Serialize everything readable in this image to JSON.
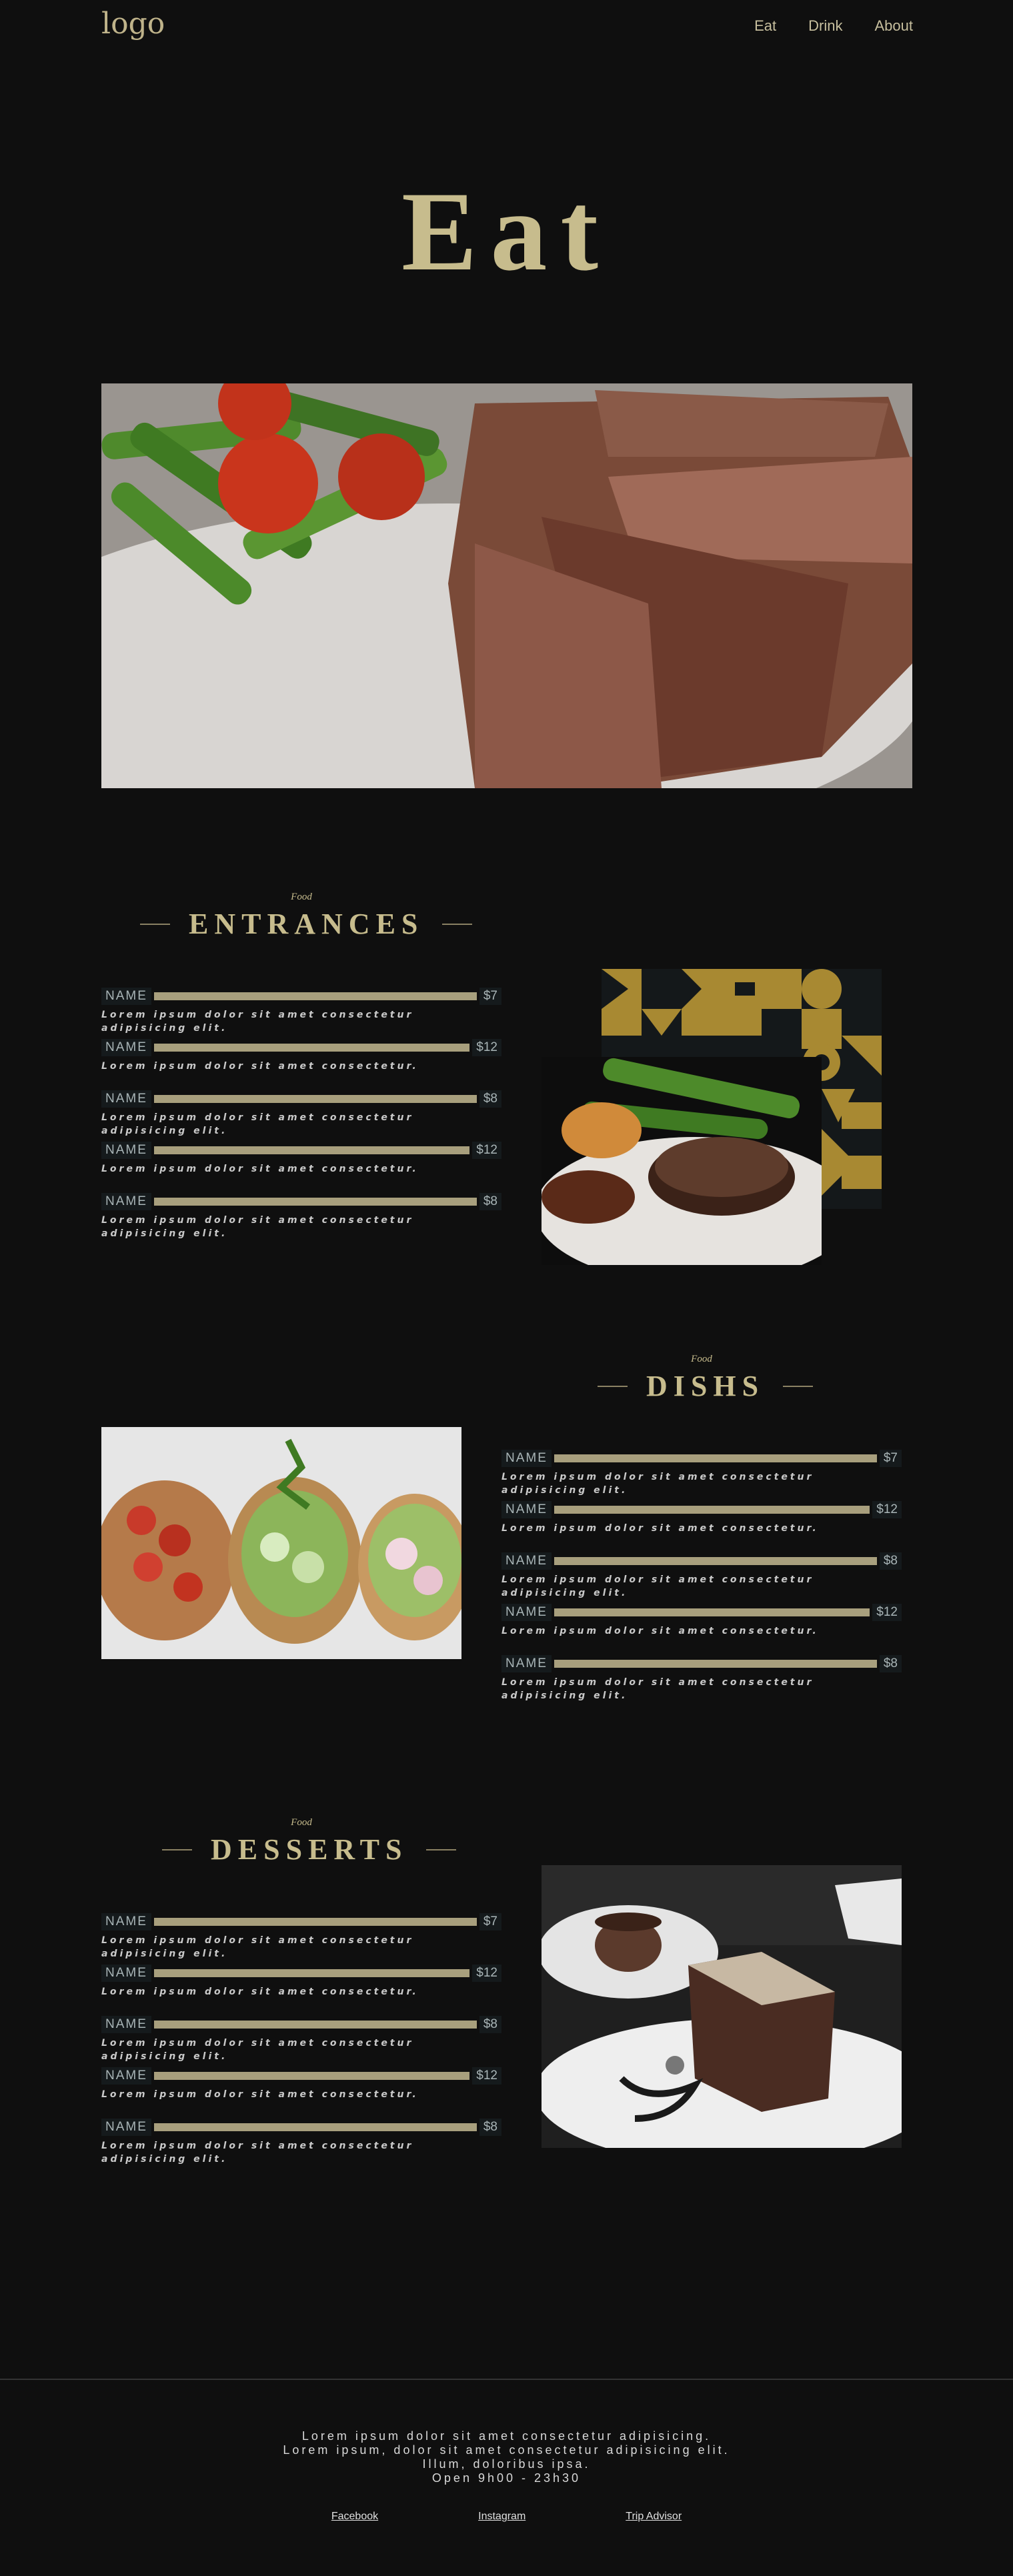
{
  "nav": {
    "logo": "logo",
    "links": [
      "Eat",
      "Drink",
      "About"
    ]
  },
  "hero": {
    "title": "Eat"
  },
  "sections": [
    {
      "kicker": "Food",
      "title": "ENTRANCES",
      "items": [
        {
          "name": "NAME",
          "price": "$7",
          "desc": "Lorem ipsum dolor sit amet consectetur adipisicing elit."
        },
        {
          "name": "NAME",
          "price": "$12",
          "desc": "Lorem ipsum dolor sit amet consectetur."
        },
        {
          "name": "NAME",
          "price": "$8",
          "desc": "Lorem ipsum dolor sit amet consectetur adipisicing elit."
        },
        {
          "name": "NAME",
          "price": "$12",
          "desc": "Lorem ipsum dolor sit amet consectetur."
        },
        {
          "name": "NAME",
          "price": "$8",
          "desc": "Lorem ipsum dolor sit amet consectetur adipisicing elit."
        }
      ]
    },
    {
      "kicker": "Food",
      "title": "DISHS",
      "items": [
        {
          "name": "NAME",
          "price": "$7",
          "desc": "Lorem ipsum dolor sit amet consectetur adipisicing elit."
        },
        {
          "name": "NAME",
          "price": "$12",
          "desc": "Lorem ipsum dolor sit amet consectetur."
        },
        {
          "name": "NAME",
          "price": "$8",
          "desc": "Lorem ipsum dolor sit amet consectetur adipisicing elit."
        },
        {
          "name": "NAME",
          "price": "$12",
          "desc": "Lorem ipsum dolor sit amet consectetur."
        },
        {
          "name": "NAME",
          "price": "$8",
          "desc": "Lorem ipsum dolor sit amet consectetur adipisicing elit."
        }
      ]
    },
    {
      "kicker": "Food",
      "title": "DESSERTS",
      "items": [
        {
          "name": "NAME",
          "price": "$7",
          "desc": "Lorem ipsum dolor sit amet consectetur adipisicing elit."
        },
        {
          "name": "NAME",
          "price": "$12",
          "desc": "Lorem ipsum dolor sit amet consectetur."
        },
        {
          "name": "NAME",
          "price": "$8",
          "desc": "Lorem ipsum dolor sit amet consectetur adipisicing elit."
        },
        {
          "name": "NAME",
          "price": "$12",
          "desc": "Lorem ipsum dolor sit amet consectetur."
        },
        {
          "name": "NAME",
          "price": "$8",
          "desc": "Lorem ipsum dolor sit amet consectetur adipisicing elit."
        }
      ]
    }
  ],
  "footer": {
    "lines": [
      "Lorem ipsum dolor sit amet consectetur adipisicing.",
      "Lorem ipsum, dolor sit amet consectetur adipisicing elit.",
      "Illum, doloribus ipsa.",
      "Open 9h00 - 23h30"
    ],
    "links": [
      "Facebook",
      "Instagram",
      "Trip Advisor"
    ]
  },
  "colors": {
    "background": "#0f0f0f",
    "accent_gold": "#c7bc8d",
    "bar": "#a89f7d",
    "label_bg": "#151a1c"
  }
}
